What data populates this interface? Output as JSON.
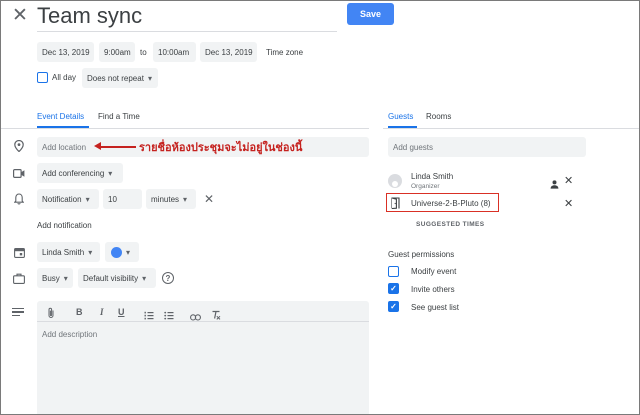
{
  "header": {
    "title": "Team sync",
    "save_label": "Save"
  },
  "datetime": {
    "start_date": "Dec 13, 2019",
    "start_time": "9:00am",
    "to_label": "to",
    "end_time": "10:00am",
    "end_date": "Dec 13, 2019",
    "timezone_label": "Time zone",
    "all_day_label": "All day",
    "repeat_value": "Does not repeat"
  },
  "tabs": {
    "event_details": "Event Details",
    "find_time": "Find a Time"
  },
  "details": {
    "location_placeholder": "Add location",
    "annotation": "รายชื่อห้องประชุมจะไม่อยู่ในช่องนี้",
    "conferencing_label": "Add conferencing",
    "notification_type": "Notification",
    "notification_amount": "10",
    "notification_unit": "minutes",
    "add_notification_label": "Add notification",
    "calendar_owner": "Linda Smith",
    "status_value": "Busy",
    "visibility_value": "Default visibility",
    "description_placeholder": "Add description"
  },
  "right_tabs": {
    "guests": "Guests",
    "rooms": "Rooms"
  },
  "guests": {
    "add_placeholder": "Add guests",
    "list": [
      {
        "name": "Linda Smith",
        "role": "Organizer"
      },
      {
        "name": "Universe-2-B-Pluto (8)"
      }
    ],
    "suggested_times_label": "SUGGESTED TIMES",
    "permissions_heading": "Guest permissions",
    "permissions": [
      {
        "label": "Modify event",
        "checked": false
      },
      {
        "label": "Invite others",
        "checked": true
      },
      {
        "label": "See guest list",
        "checked": true
      }
    ]
  },
  "colors": {
    "accent": "#1a73e8",
    "save_button": "#4285f4",
    "annotation": "#c5221f",
    "highlight_box": "#d93025",
    "event_color": "#4285f4"
  }
}
